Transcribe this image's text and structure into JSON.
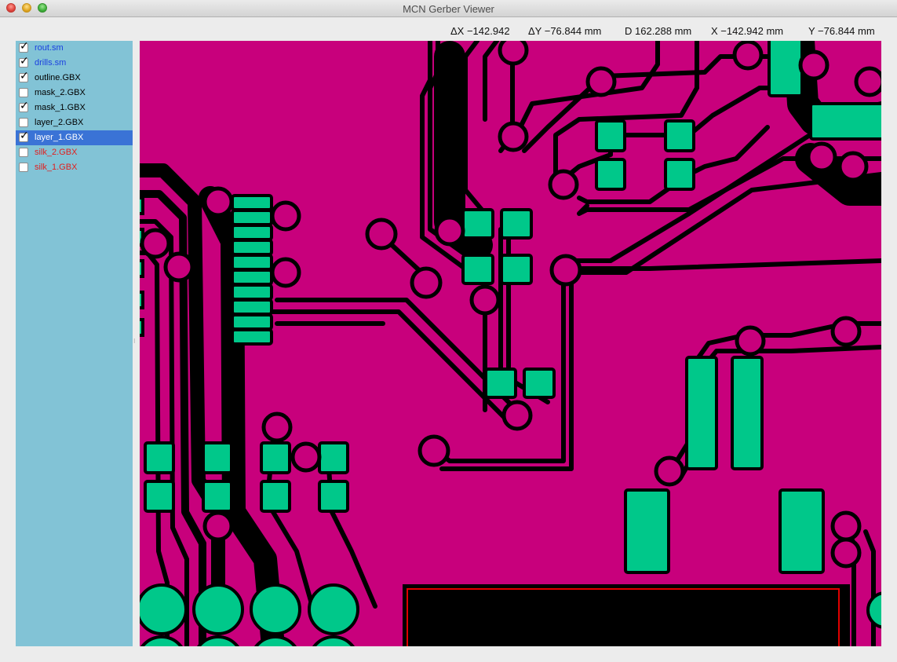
{
  "window": {
    "title": "MCN Gerber Viewer"
  },
  "readout": {
    "dx": "ΔX −142.942",
    "dy": "ΔY −76.844 mm",
    "d": "D 162.288 mm",
    "x": "X −142.942 mm",
    "y": "Y −76.844 mm"
  },
  "layers": [
    {
      "label": "rout.sm",
      "checked": true,
      "color": "#1a3fe0"
    },
    {
      "label": "drills.sm",
      "checked": true,
      "color": "#1a3fe0"
    },
    {
      "label": "outline.GBX",
      "checked": true,
      "color": "#000000"
    },
    {
      "label": "mask_2.GBX",
      "checked": false,
      "color": "#000000"
    },
    {
      "label": "mask_1.GBX",
      "checked": true,
      "color": "#000000"
    },
    {
      "label": "layer_2.GBX",
      "checked": false,
      "color": "#000000"
    },
    {
      "label": "layer_1.GBX",
      "checked": true,
      "color": "#ffffff",
      "selected": true
    },
    {
      "label": "silk_2.GBX",
      "checked": false,
      "color": "#e02020"
    },
    {
      "label": "silk_1.GBX",
      "checked": false,
      "color": "#e02020"
    }
  ],
  "colors": {
    "board": "#c8007c",
    "copper": "#00c88a",
    "outline": "#000000",
    "silk": "#e00000",
    "sidebar": "#82c3d6",
    "selection": "#3a73d6"
  },
  "check_mark": "✓"
}
